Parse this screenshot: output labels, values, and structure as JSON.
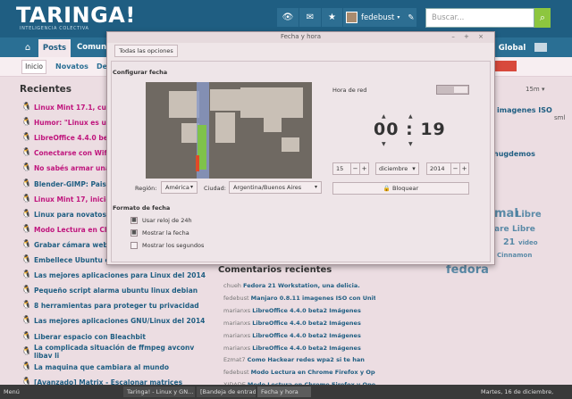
{
  "header": {
    "logo": "TARINGA!",
    "tagline": "INTELIGENCIA COLECTIVA",
    "username": "fedebust",
    "search_placeholder": "Buscar...",
    "icons": [
      "eye-icon",
      "mail-icon",
      "star-icon",
      "edit-icon",
      "search-icon"
    ]
  },
  "nav": {
    "posts": "Posts",
    "comunidades": "Comuni",
    "global": "Global"
  },
  "subnav": {
    "tabs": [
      "Inicio",
      "Novatos",
      "De"
    ]
  },
  "recientes": {
    "title": "Recientes",
    "period": "15m",
    "posts": [
      {
        "title": "Linux Mint 17.1, cuido",
        "color": "#c0157d"
      },
      {
        "title": "Humor: \"Linux es un l",
        "color": "#c0157d"
      },
      {
        "title": "LibreOffice 4.4.0 beta2",
        "color": "#c0157d"
      },
      {
        "title": "Conectarse con Wifi s",
        "color": "#c0157d"
      },
      {
        "title": "No sabés armar una re",
        "color": "#c0157d"
      },
      {
        "title": "Blender-GIMP: Paisaje",
        "color": "#1f5e82"
      },
      {
        "title": "Linux Mint 17, inicio d",
        "color": "#c0157d"
      },
      {
        "title": "Linux para novatos: 1",
        "color": "#1f5e82"
      },
      {
        "title": "Modo Lectura en Chro",
        "color": "#c0157d"
      },
      {
        "title": "Grabar cámara web d",
        "color": "#1f5e82"
      },
      {
        "title": "Embellece Ubuntu co",
        "color": "#1f5e82"
      },
      {
        "title": "Las mejores aplicaciones para Linux del 2014",
        "color": "#1f5e82"
      },
      {
        "title": "Pequeño script alarma ubuntu linux debian",
        "color": "#1f5e82"
      },
      {
        "title": "8 herramientas para proteger tu privacidad",
        "color": "#1f5e82"
      },
      {
        "title": "Las mejores aplicaciones GNU/Linux del 2014",
        "color": "#1f5e82"
      },
      {
        "title": "Liberar espacio con Bleachbit",
        "color": "#1f5e82"
      },
      {
        "title": "La complicada situación de ffmpeg avconv libav li",
        "color": "#1f5e82"
      },
      {
        "title": "La maquina que cambiara al mundo",
        "color": "#1f5e82"
      },
      {
        "title": "[Avanzado] Matrix - Escalonar matrices",
        "color": "#1f5e82"
      }
    ]
  },
  "right": {
    "imagenes_iso": "imagenes ISO",
    "sml": "sml",
    "hugdemos": "hugdemos",
    "tags": [
      "mal",
      "Libre",
      "are",
      "Libre",
      "21",
      "video",
      "Cinnamon",
      "fedora"
    ]
  },
  "comments": {
    "title": "Comentarios recientes",
    "items": [
      {
        "user": "chueh",
        "text": "Fedora 21 Workstation, una delicia."
      },
      {
        "user": "fedebust",
        "text": "Manjaro 0.8.11 imagenes ISO con Unity y"
      },
      {
        "user": "marianxs",
        "text": "LibreOffice 4.4.0 beta2 Imágenes"
      },
      {
        "user": "marianxs",
        "text": "LibreOffice 4.4.0 beta2 Imágenes"
      },
      {
        "user": "marianxs",
        "text": "LibreOffice 4.4.0 beta2 Imágenes"
      },
      {
        "user": "marianxs",
        "text": "LibreOffice 4.4.0 beta2 Imágenes"
      },
      {
        "user": "Ezmat7",
        "text": "Como Hackear redes wpa2 si te han"
      },
      {
        "user": "fedebust",
        "text": "Modo Lectura en Chrome Firefox y Opera"
      },
      {
        "user": "XIDADE",
        "text": "Modo Lectura en Chrome Firefox y Opera"
      }
    ]
  },
  "dialog": {
    "title": "Fecha y hora",
    "controls": "– + ×",
    "all_options": "Todas las opciones",
    "config_title": "Configurar fecha",
    "region_label": "Región:",
    "region_value": "América",
    "city_label": "Ciudad:",
    "city_value": "Argentina/Buenos Aires",
    "network_time_label": "Hora de red",
    "hours": "00",
    "sep": ":",
    "minutes": "19",
    "day": "15",
    "month": "diciembre",
    "year": "2014",
    "lock_label": "Bloquear",
    "format_title": "Formato de fecha",
    "options": [
      {
        "label": "Usar reloj de 24h",
        "checked": true
      },
      {
        "label": "Mostrar la fecha",
        "checked": true
      },
      {
        "label": "Mostrar los segundos",
        "checked": false
      }
    ]
  },
  "taskbar": {
    "menu": "Menú",
    "tasks": [
      "Taringa! - Linux y GN...",
      "[Bandeja de entrada ...",
      "Fecha y hora"
    ],
    "clock": "Martes, 16 de diciembre, 00:19"
  }
}
